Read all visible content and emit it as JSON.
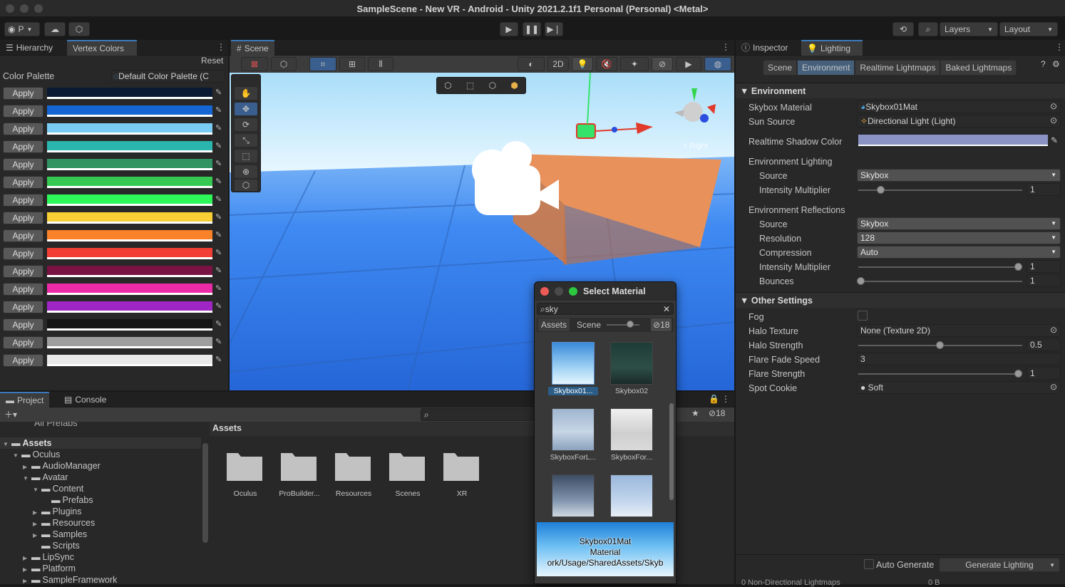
{
  "window": {
    "title": "SampleScene - New VR - Android - Unity 2021.2.1f1 Personal (Personal) <Metal>"
  },
  "toolbar": {
    "account": "P",
    "layers": "Layers",
    "layout": "Layout"
  },
  "hierarchy": {
    "tabs": [
      "Hierarchy",
      "Vertex Colors"
    ],
    "reset": "Reset",
    "palette_label": "Color Palette",
    "palette_value": "Default Color Palette (C",
    "apply_label": "Apply",
    "colors": [
      "#0b1a33",
      "#1566d2",
      "#79cdf4",
      "#2ab6ae",
      "#2f9362",
      "#35c852",
      "#2ef75a",
      "#f7cf34",
      "#f98228",
      "#f23e34",
      "#7a1244",
      "#ea2aa6",
      "#9f25c5",
      "#151515",
      "#9e9e9e",
      "#e9e9e9"
    ]
  },
  "scene": {
    "tab": "Scene",
    "mode_2d": "2D",
    "gizmo_label": "< Right",
    "colors": {
      "sky_top": "#bfe8fb",
      "floor": "#2a78ee",
      "box": "#e39055"
    }
  },
  "select_material": {
    "title": "Select Material",
    "search": "sky",
    "tab_assets": "Assets",
    "tab_scene": "Scene",
    "hidden_count": "18",
    "items": [
      {
        "name": "Skybox01...",
        "selected": true
      },
      {
        "name": "Skybox02",
        "selected": false
      },
      {
        "name": "SkyboxForL...",
        "selected": false
      },
      {
        "name": "SkyboxFor...",
        "selected": false
      },
      {
        "name": "",
        "selected": false
      },
      {
        "name": "",
        "selected": false
      }
    ],
    "preview_name": "Skybox01Mat",
    "preview_type": "Material",
    "preview_path": "ork/Usage/SharedAssets/Skyb"
  },
  "inspector": {
    "tabs": [
      "Inspector",
      "Lighting"
    ],
    "subtabs": [
      "Scene",
      "Environment",
      "Realtime Lightmaps",
      "Baked Lightmaps"
    ],
    "environment_header": "Environment",
    "skybox_material_label": "Skybox Material",
    "skybox_material_value": "Skybox01Mat",
    "sun_source_label": "Sun Source",
    "sun_source_value": "Directional Light (Light)",
    "shadow_color_label": "Realtime Shadow Color",
    "env_lighting_label": "Environment Lighting",
    "source_label": "Source",
    "source_value": "Skybox",
    "intensity_label": "Intensity Multiplier",
    "intensity_value": "1",
    "env_reflections_label": "Environment Reflections",
    "refl_source_label": "Source",
    "refl_source_value": "Skybox",
    "resolution_label": "Resolution",
    "resolution_value": "128",
    "compression_label": "Compression",
    "compression_value": "Auto",
    "refl_intensity_label": "Intensity Multiplier",
    "refl_intensity_value": "1",
    "bounces_label": "Bounces",
    "bounces_value": "1",
    "other_header": "Other Settings",
    "fog_label": "Fog",
    "halo_texture_label": "Halo Texture",
    "halo_texture_value": "None (Texture 2D)",
    "halo_strength_label": "Halo Strength",
    "halo_strength_value": "0.5",
    "flare_fade_label": "Flare Fade Speed",
    "flare_fade_value": "3",
    "flare_strength_label": "Flare Strength",
    "flare_strength_value": "1",
    "spot_cookie_label": "Spot Cookie",
    "spot_cookie_value": "Soft",
    "auto_generate": "Auto Generate",
    "generate_lighting": "Generate Lighting",
    "footer_left": "0 Non-Directional Lightmaps",
    "footer_right": "0 B",
    "shadow_color": "#8a93c4"
  },
  "project": {
    "tabs": [
      "Project",
      "Console"
    ],
    "hidden_count": "18",
    "partial_item": "All Prefabs",
    "assets_header": "Assets",
    "tree": [
      {
        "label": "Assets",
        "depth": 0,
        "open": true,
        "bold": true
      },
      {
        "label": "Oculus",
        "depth": 1,
        "open": true
      },
      {
        "label": "AudioManager",
        "depth": 2,
        "open": false
      },
      {
        "label": "Avatar",
        "depth": 2,
        "open": true
      },
      {
        "label": "Content",
        "depth": 3,
        "open": true
      },
      {
        "label": "Prefabs",
        "depth": 4,
        "leaf": true
      },
      {
        "label": "Plugins",
        "depth": 3,
        "open": false
      },
      {
        "label": "Resources",
        "depth": 3,
        "open": false
      },
      {
        "label": "Samples",
        "depth": 3,
        "open": false
      },
      {
        "label": "Scripts",
        "depth": 3,
        "leaf": true
      },
      {
        "label": "LipSync",
        "depth": 2,
        "open": false
      },
      {
        "label": "Platform",
        "depth": 2,
        "open": false
      },
      {
        "label": "SampleFramework",
        "depth": 2,
        "open": false
      }
    ],
    "folders": [
      "Oculus",
      "ProBuilder...",
      "Resources",
      "Scenes",
      "XR"
    ]
  }
}
